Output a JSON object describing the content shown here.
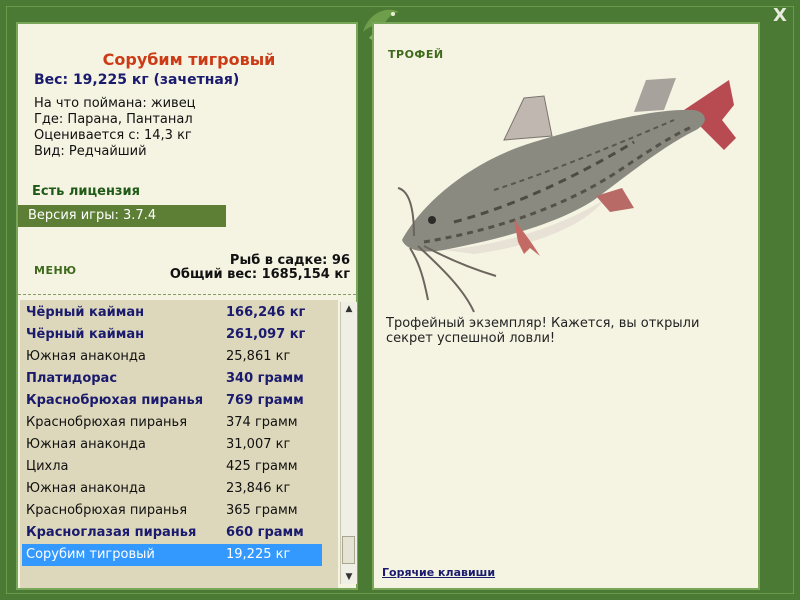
{
  "window": {
    "close_label": "X"
  },
  "fish": {
    "title": "Сорубим тигровый",
    "weight_line": "Вес: 19,225 кг (зачетная)",
    "info": [
      "На что поймана: живец",
      "Где: Парана, Пантанал",
      "Оценивается с: 14,3 кг",
      "Вид: Редчайший"
    ],
    "license": "Есть лицензия",
    "version": "Версия игры: 3.7.4"
  },
  "menu": {
    "label": "МЕНЮ"
  },
  "catch_stats": {
    "count_line": "Рыб в садке: 96",
    "total_line": "Общий вес: 1685,154 кг"
  },
  "catch_list": [
    {
      "name": "Чёрный кайман",
      "weight": "166,246 кг",
      "style": "bold"
    },
    {
      "name": "Чёрный кайман",
      "weight": "261,097 кг",
      "style": "bold"
    },
    {
      "name": "Южная анаконда",
      "weight": "25,861 кг",
      "style": "normal"
    },
    {
      "name": "Платидорас",
      "weight": "340 грамм",
      "style": "bold"
    },
    {
      "name": "Краснобрюхая пиранья",
      "weight": "769 грамм",
      "style": "bold"
    },
    {
      "name": "Краснобрюхая пиранья",
      "weight": "374 грамм",
      "style": "normal"
    },
    {
      "name": "Южная анаконда",
      "weight": "31,007 кг",
      "style": "normal"
    },
    {
      "name": "Цихла",
      "weight": "425 грамм",
      "style": "normal"
    },
    {
      "name": "Южная анаконда",
      "weight": "23,846 кг",
      "style": "normal"
    },
    {
      "name": "Краснобрюхая пиранья",
      "weight": "365 грамм",
      "style": "normal"
    },
    {
      "name": "Красноглазая пиранья",
      "weight": "660 грамм",
      "style": "bold"
    },
    {
      "name": "Сорубим тигровый",
      "weight": "19,225 кг",
      "style": "selected"
    }
  ],
  "trophy": {
    "label": "ТРОФЕЙ",
    "text": "Трофейный экземпляр! Кажется, вы открыли секрет успешной ловли!",
    "hotkeys": "Горячие клавиши"
  },
  "icons": {
    "close": "close-icon",
    "logo": "fish-logo-icon",
    "scroll_up": "scroll-up-arrow-icon",
    "scroll_down": "scroll-down-arrow-icon"
  },
  "colors": {
    "frame": "#4a7a34",
    "panel": "#f5f3e2",
    "title": "#cc3a16",
    "selected": "#3399ff"
  }
}
